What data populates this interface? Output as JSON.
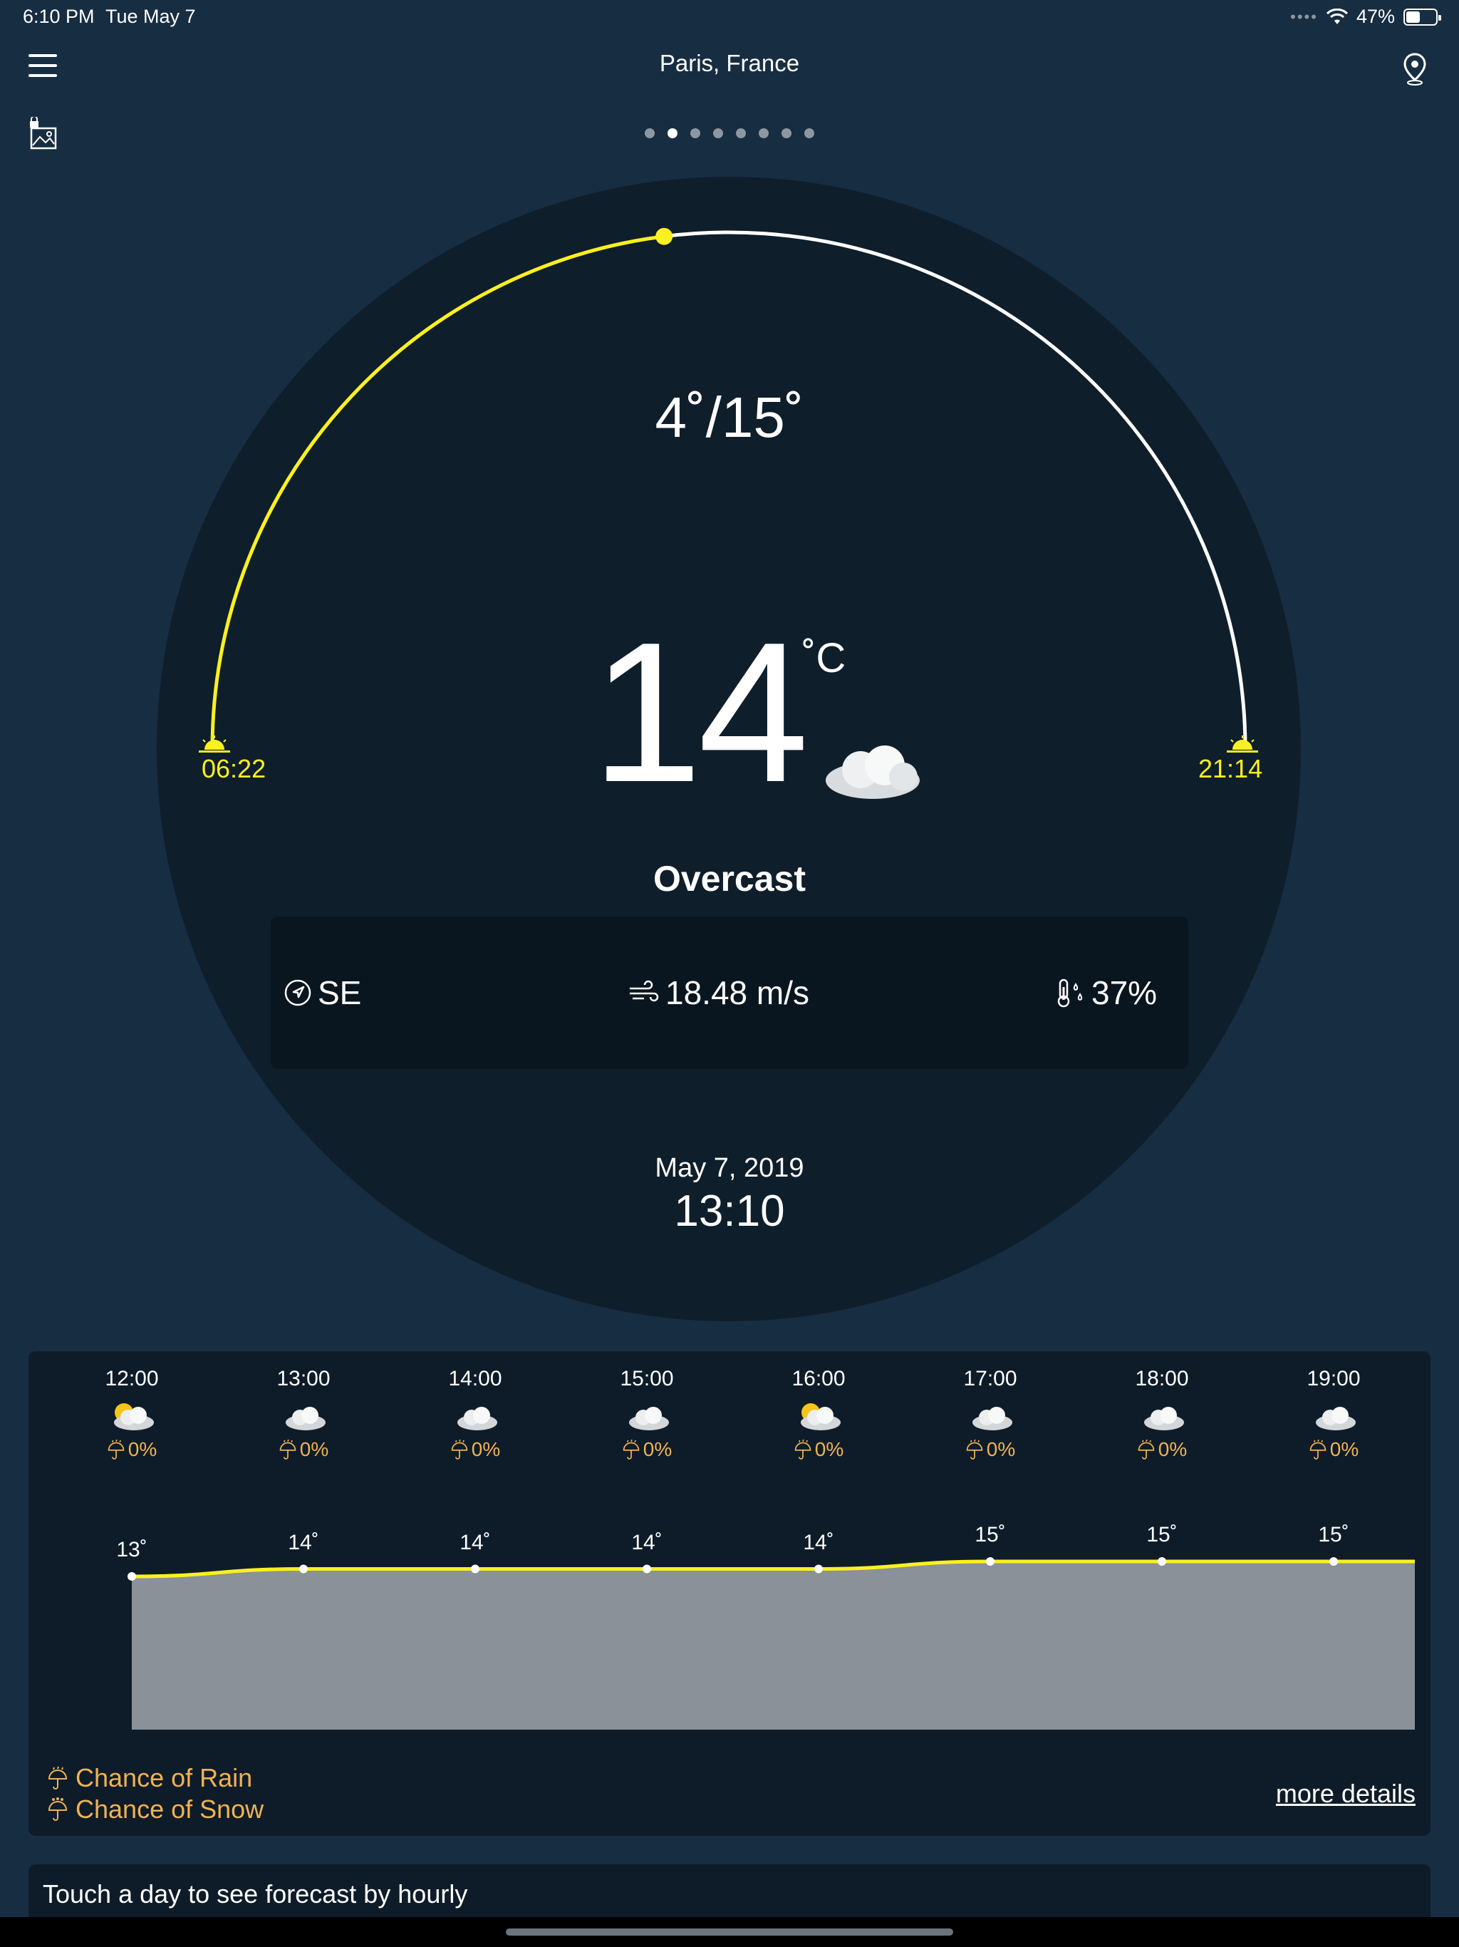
{
  "status_bar": {
    "time": "6:10 PM",
    "date": "Tue May 7",
    "battery": "47%",
    "battery_level": 0.47
  },
  "header": {
    "location": "Paris, France",
    "pages": {
      "count": 8,
      "active_index": 1
    }
  },
  "current": {
    "temp_range": "4˚/15˚",
    "temperature": "14",
    "unit": "˚C",
    "condition": "Overcast",
    "sunrise": "06:22",
    "sunset": "21:14",
    "sun_progress": 0.46,
    "wind_direction": "SE",
    "wind_speed": "18.48 m/s",
    "humidity": "37%",
    "date": "May 7, 2019",
    "time": "13:10"
  },
  "hourly": [
    {
      "time": "12:00",
      "icon": "partly-sunny-icon",
      "rain": "0%",
      "temp_label": "13˚",
      "temp": 13
    },
    {
      "time": "13:00",
      "icon": "cloud-icon",
      "rain": "0%",
      "temp_label": "14˚",
      "temp": 14
    },
    {
      "time": "14:00",
      "icon": "cloud-icon",
      "rain": "0%",
      "temp_label": "14˚",
      "temp": 14
    },
    {
      "time": "15:00",
      "icon": "cloud-icon",
      "rain": "0%",
      "temp_label": "14˚",
      "temp": 14
    },
    {
      "time": "16:00",
      "icon": "partly-sunny-icon",
      "rain": "0%",
      "temp_label": "14˚",
      "temp": 14
    },
    {
      "time": "17:00",
      "icon": "cloud-icon",
      "rain": "0%",
      "temp_label": "15˚",
      "temp": 15
    },
    {
      "time": "18:00",
      "icon": "cloud-icon",
      "rain": "0%",
      "temp_label": "15˚",
      "temp": 15
    },
    {
      "time": "19:00",
      "icon": "cloud-icon",
      "rain": "0%",
      "temp_label": "15˚",
      "temp": 15
    }
  ],
  "legend": {
    "rain": "Chance of Rain",
    "snow": "Chance of Snow"
  },
  "more_details": "more details",
  "hint": "Touch a day to see forecast by hourly",
  "colors": {
    "background": "#172d42",
    "dial": "#0f1e2b",
    "accent_yellow": "#fbf020",
    "rain_orange": "#f0b253",
    "chart_fill": "#8a9199"
  }
}
